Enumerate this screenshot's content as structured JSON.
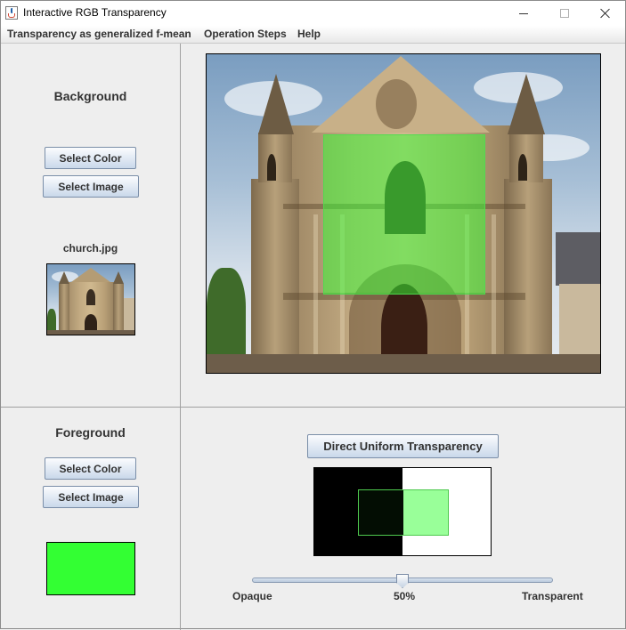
{
  "window": {
    "title": "Interactive RGB Transparency",
    "controls": [
      "minimize-icon",
      "maximize-icon",
      "close-icon"
    ]
  },
  "menu": {
    "items": [
      "Transparency as generalized f-mean",
      "Operation Steps",
      "Help"
    ]
  },
  "background_panel": {
    "title": "Background",
    "select_color_label": "Select Color",
    "select_image_label": "Select Image",
    "file_name": "church.jpg"
  },
  "foreground_panel": {
    "title": "Foreground",
    "select_color_label": "Select Color",
    "select_image_label": "Select Image",
    "color": "#33ff33"
  },
  "transparency": {
    "button_label": "Direct Uniform Transparency",
    "value": 0.5,
    "value_label": "50%",
    "min_label": "Opaque",
    "max_label": "Transparent"
  },
  "colors": {
    "accent": "#33ff33",
    "preview_left": "#000000",
    "preview_right": "#ffffff"
  }
}
